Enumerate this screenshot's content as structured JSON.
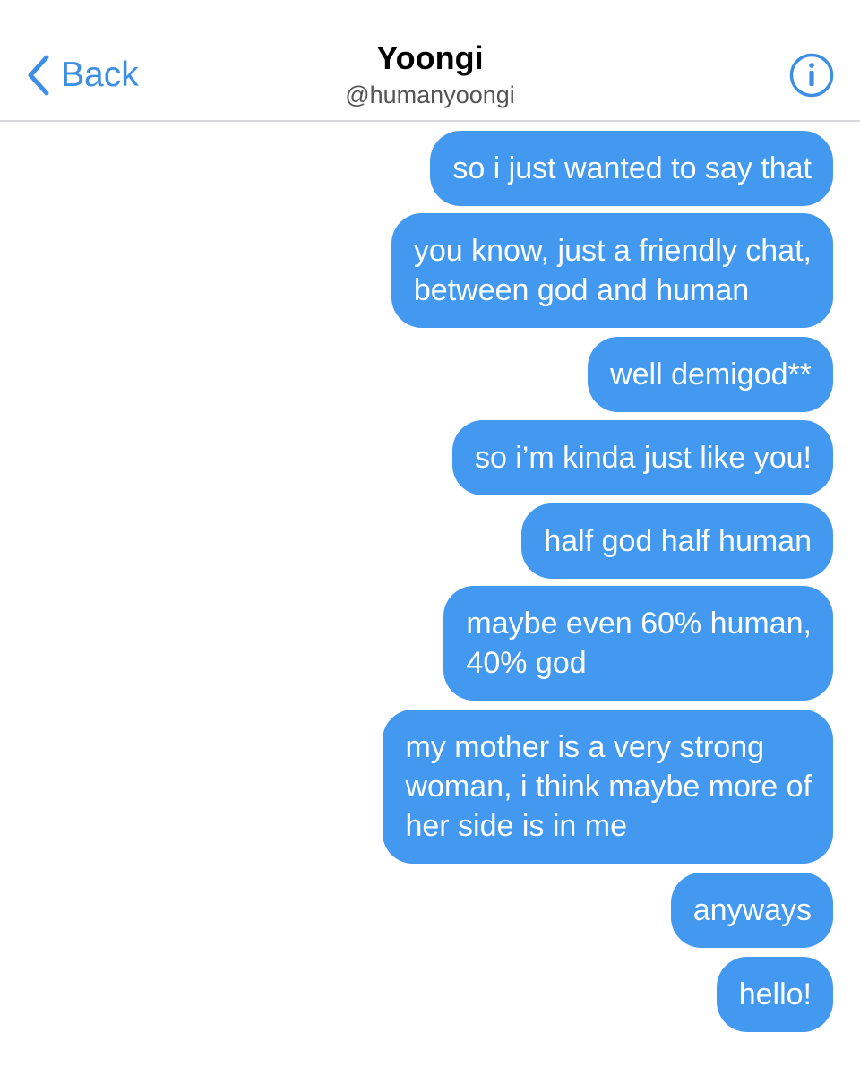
{
  "header": {
    "back_label": "Back",
    "contact_name": "Yoongi",
    "contact_handle": "@humanyoongi"
  },
  "icons": {
    "back": "chevron-left-icon",
    "info": "info-circle-icon"
  },
  "colors": {
    "accent": "#3d8fe6",
    "bubble": "#4398ef",
    "bubble_text": "#ffffff"
  },
  "messages": [
    {
      "sender": "me",
      "text": "so i just wanted to say that"
    },
    {
      "sender": "me",
      "text": "you know, just a friendly chat,\nbetween god and human"
    },
    {
      "sender": "me",
      "text": "well demigod**"
    },
    {
      "sender": "me",
      "text": "so i’m kinda just like you!"
    },
    {
      "sender": "me",
      "text": "half god half human"
    },
    {
      "sender": "me",
      "text": "maybe even 60% human,\n40% god"
    },
    {
      "sender": "me",
      "text": "my mother is a very strong\nwoman, i think maybe more of\nher side is in me"
    },
    {
      "sender": "me",
      "text": "anyways"
    },
    {
      "sender": "me",
      "text": "hello!"
    }
  ]
}
